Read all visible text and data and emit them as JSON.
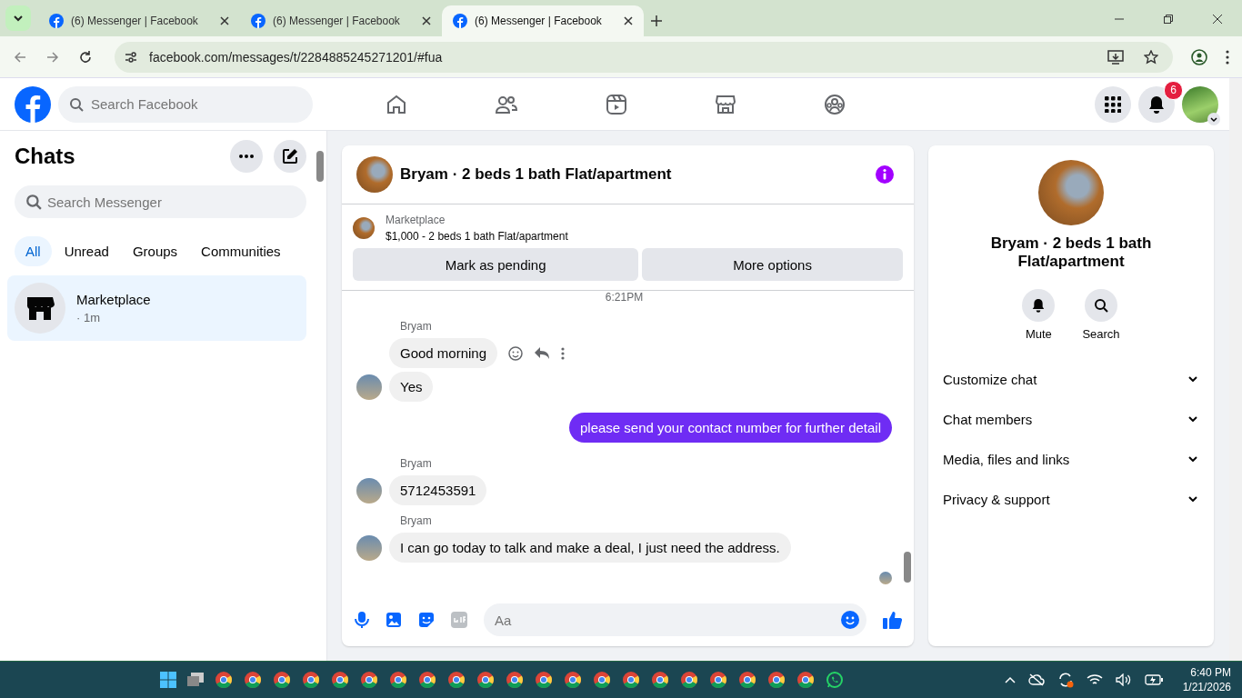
{
  "browser": {
    "tabs": [
      {
        "title": "(6) Messenger | Facebook",
        "selected": false
      },
      {
        "title": "(6) Messenger | Facebook",
        "selected": false
      },
      {
        "title": "(6) Messenger | Facebook",
        "selected": true
      }
    ],
    "url": "facebook.com/messages/t/2284885245271201/#fua"
  },
  "topbar": {
    "search_placeholder": "Search Facebook",
    "notification_count": "6"
  },
  "chats": {
    "title": "Chats",
    "search_placeholder": "Search Messenger",
    "filters": [
      {
        "label": "All",
        "selected": true
      },
      {
        "label": "Unread",
        "selected": false
      },
      {
        "label": "Groups",
        "selected": false
      },
      {
        "label": "Communities",
        "selected": false
      }
    ],
    "items": [
      {
        "name": "Marketplace",
        "meta": "· 1m",
        "selected": true
      }
    ]
  },
  "conversation": {
    "title": "Bryam · 2 beds 1 bath Flat/apartment",
    "listing": {
      "source": "Marketplace",
      "description": "$1,000 - 2 beds 1 bath Flat/apartment",
      "buttons": [
        "Mark as pending",
        "More options"
      ]
    },
    "messages": [
      {
        "kind": "time",
        "text": "6:21PM"
      },
      {
        "kind": "in",
        "sender": "Bryam",
        "bubbles": [
          "Good morning",
          "Yes"
        ]
      },
      {
        "kind": "out",
        "bubbles": [
          "please send your contact number for further detail"
        ]
      },
      {
        "kind": "in",
        "sender": "Bryam",
        "bubbles": [
          "5712453591"
        ]
      },
      {
        "kind": "in",
        "sender": "Bryam",
        "bubbles": [
          "I can go today to talk and make a deal, I just need the address."
        ]
      }
    ],
    "composer_placeholder": "Aa"
  },
  "details": {
    "name": "Bryam · 2 beds 1 bath Flat/apartment",
    "actions": [
      "Mute",
      "Search"
    ],
    "sections": [
      {
        "label": "Customize chat",
        "expanded": false
      },
      {
        "label": "Chat members",
        "expanded": false
      },
      {
        "label": "Media, files and links",
        "expanded": false
      },
      {
        "label": "Privacy & support",
        "expanded": false
      }
    ]
  },
  "taskbar": {
    "time": "6:40 PM",
    "date": "1/21/2026"
  }
}
